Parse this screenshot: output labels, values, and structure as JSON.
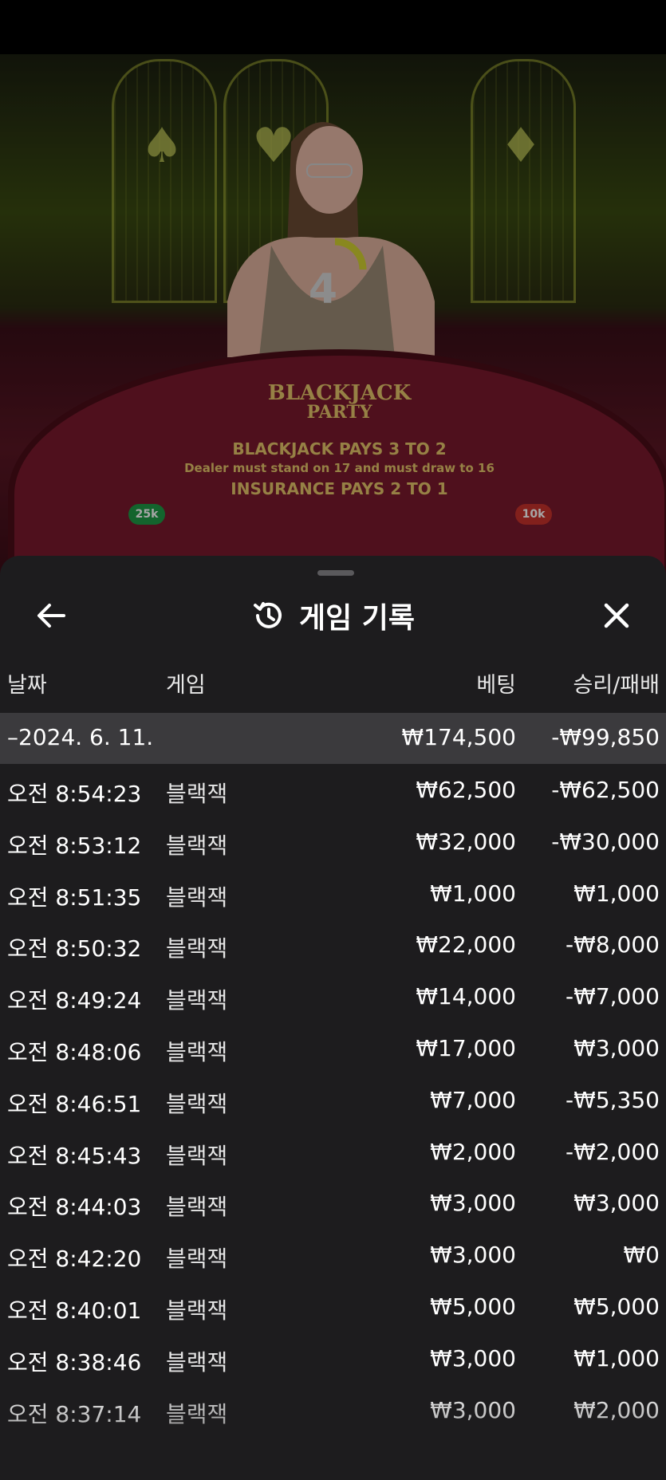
{
  "video": {
    "table_brand_line1": "BLACKJACK",
    "table_brand_line2": "PARTY",
    "table_arc_line1": "BLACKJACK PAYS 3 TO 2",
    "table_arc_line2": "Dealer must stand on 17 and must draw to 16",
    "table_arc_line3": "INSURANCE PAYS 2 TO 1",
    "chip_left": "25k",
    "chip_right": "10k",
    "countdown": "4"
  },
  "sheet": {
    "title": "게임 기록",
    "back_icon": "arrow-left-icon",
    "history_icon": "history-clock-icon",
    "close_icon": "close-x-icon"
  },
  "columns": {
    "date": "날짜",
    "game": "게임",
    "bet": "베팅",
    "result": "승리/패배"
  },
  "date_group": {
    "date": "–2024. 6. 11.",
    "bet_total": "₩174,500",
    "result_total": "-₩99,850"
  },
  "rows": [
    {
      "time": "오전 8:54:23",
      "game": "블랙잭",
      "bet": "₩62,500",
      "result": "-₩62,500"
    },
    {
      "time": "오전 8:53:12",
      "game": "블랙잭",
      "bet": "₩32,000",
      "result": "-₩30,000"
    },
    {
      "time": "오전 8:51:35",
      "game": "블랙잭",
      "bet": "₩1,000",
      "result": "₩1,000"
    },
    {
      "time": "오전 8:50:32",
      "game": "블랙잭",
      "bet": "₩22,000",
      "result": "-₩8,000"
    },
    {
      "time": "오전 8:49:24",
      "game": "블랙잭",
      "bet": "₩14,000",
      "result": "-₩7,000"
    },
    {
      "time": "오전 8:48:06",
      "game": "블랙잭",
      "bet": "₩17,000",
      "result": "₩3,000"
    },
    {
      "time": "오전 8:46:51",
      "game": "블랙잭",
      "bet": "₩7,000",
      "result": "-₩5,350"
    },
    {
      "time": "오전 8:45:43",
      "game": "블랙잭",
      "bet": "₩2,000",
      "result": "-₩2,000"
    },
    {
      "time": "오전 8:44:03",
      "game": "블랙잭",
      "bet": "₩3,000",
      "result": "₩3,000"
    },
    {
      "time": "오전 8:42:20",
      "game": "블랙잭",
      "bet": "₩3,000",
      "result": "₩0"
    },
    {
      "time": "오전 8:40:01",
      "game": "블랙잭",
      "bet": "₩5,000",
      "result": "₩5,000"
    },
    {
      "time": "오전 8:38:46",
      "game": "블랙잭",
      "bet": "₩3,000",
      "result": "₩1,000"
    },
    {
      "time": "오전 8:37:14",
      "game": "블랙잭",
      "bet": "₩3,000",
      "result": "₩2,000"
    }
  ]
}
